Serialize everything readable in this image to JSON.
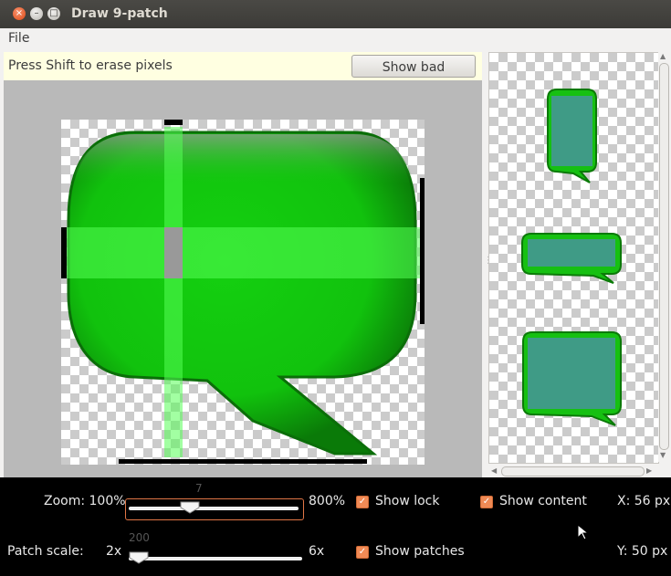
{
  "window": {
    "title": "Draw 9-patch",
    "controls": {
      "close": "×",
      "minimize": "–",
      "maximize": "□"
    }
  },
  "menubar": {
    "items": [
      "File"
    ]
  },
  "editor": {
    "hint": "Press Shift to erase pixels",
    "bad_patches_button": "Show bad patches"
  },
  "controls": {
    "zoom": {
      "label": "Zoom: 100%",
      "max_label": "800%",
      "value": "7",
      "level": 0.12
    },
    "patch_scale": {
      "label": "Patch scale:",
      "min_label": "2x",
      "max_label": "6x",
      "value": "200",
      "level": 0.0
    },
    "show_lock": {
      "label": "Show lock",
      "checked": true
    },
    "show_content": {
      "label": "Show content",
      "checked": true
    },
    "show_patches": {
      "label": "Show patches",
      "checked": true
    },
    "x_readout": "X: 56 px",
    "y_readout": "Y: 50 px"
  },
  "colors": {
    "bubble_green": "#12c80e",
    "patch_overlay": "#55ff55",
    "content_teal": "#3f9b86",
    "accent_orange": "#f08a55"
  },
  "icons": {
    "checkbox": "check-icon",
    "cursor": "mouse-pointer-icon"
  }
}
